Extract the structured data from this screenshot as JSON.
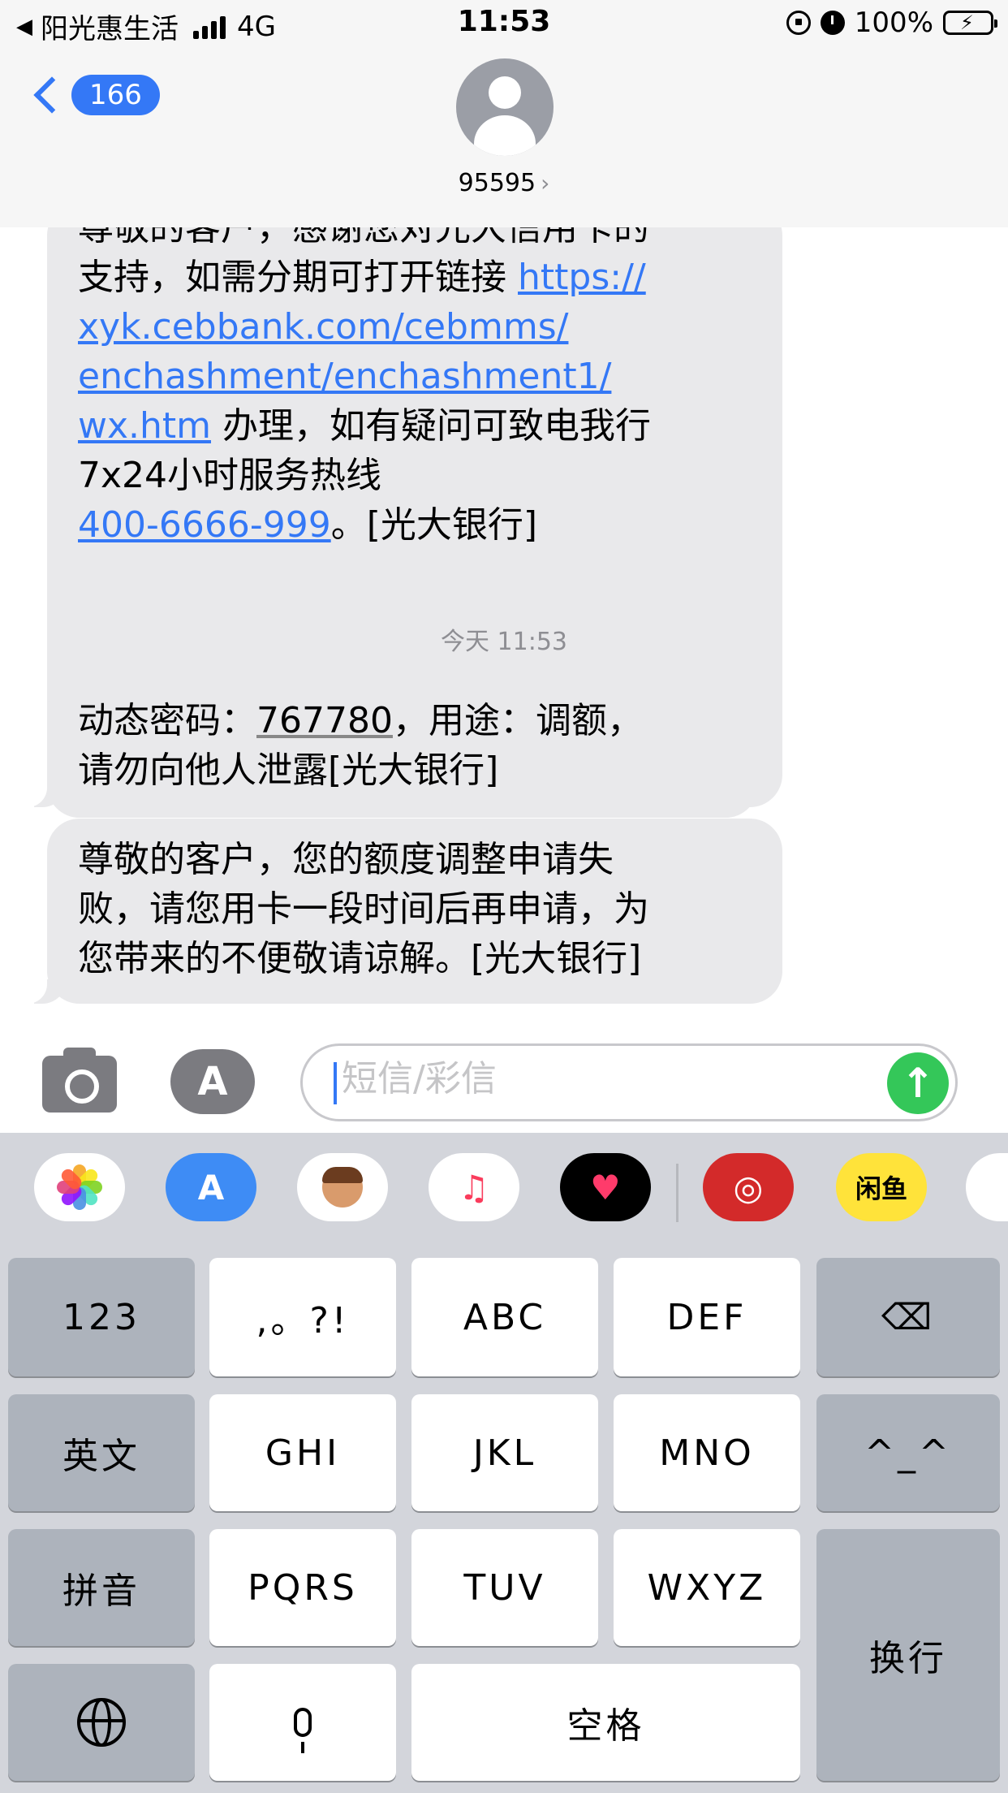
{
  "status": {
    "carrier": "阳光惠生活",
    "network": "4G",
    "time": "11:53",
    "battery": "100%"
  },
  "nav": {
    "back_count": "166",
    "contact": "95595"
  },
  "messages": {
    "m1": {
      "line1": "尊敬的客户，感谢您对光大信用卡的",
      "line2_text": "支持，如需分期可打开链接 ",
      "line2_link": "https://",
      "line3_link": "xyk.cebbank.com/cebmms/",
      "line4_link": "enchashment/enchashment1/",
      "line5_link": "wx.htm",
      "line5_text": " 办理，如有疑问可致电我行",
      "line6": "7x24小时服务热线",
      "line7_link": "400-6666-999",
      "line7_text": "。[光大银行]"
    },
    "timestamp": "今天 11:53",
    "m2": {
      "prefix": "动态密码：",
      "code": "767780",
      "suffix": "，用途：调额，",
      "line2": "请勿向他人泄露[光大银行]"
    },
    "m3": {
      "line1": "尊敬的客户，您的额度调整申请失",
      "line2": "败，请您用卡一段时间后再申请，为",
      "line3": "您带来的不便敬请谅解。[光大银行]"
    }
  },
  "input": {
    "placeholder": "短信/彩信"
  },
  "apps": {
    "xianyu": "闲鱼"
  },
  "keyboard": {
    "row1": [
      "123",
      ",。?!",
      "ABC",
      "DEF"
    ],
    "row2": [
      "英文",
      "GHI",
      "JKL",
      "MNO",
      "^_^"
    ],
    "row3": [
      "拼音",
      "PQRS",
      "TUV",
      "WXYZ"
    ],
    "return": "换行",
    "space": "空格"
  }
}
